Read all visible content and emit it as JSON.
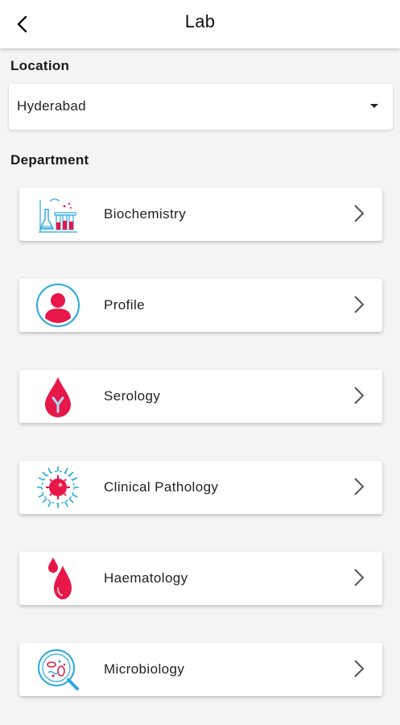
{
  "header": {
    "title": "Lab",
    "back_icon": "arrow-back-icon"
  },
  "location": {
    "label": "Location",
    "selected": "Hyderabad",
    "caret_icon": "dropdown-caret-icon"
  },
  "department": {
    "label": "Department",
    "items": [
      {
        "label": "Biochemistry",
        "icon": "lab-flask-icon"
      },
      {
        "label": "Profile",
        "icon": "user-profile-icon"
      },
      {
        "label": "Serology",
        "icon": "blood-antibody-icon"
      },
      {
        "label": "Clinical Pathology",
        "icon": "cell-virus-icon"
      },
      {
        "label": "Haematology",
        "icon": "blood-drops-icon"
      },
      {
        "label": "Microbiology",
        "icon": "microscope-petri-icon"
      }
    ],
    "chevron_icon": "chevron-right-icon"
  },
  "colors": {
    "accent_red": "#e8174a",
    "accent_blue": "#29a8e0",
    "background": "#f4f4f4"
  }
}
